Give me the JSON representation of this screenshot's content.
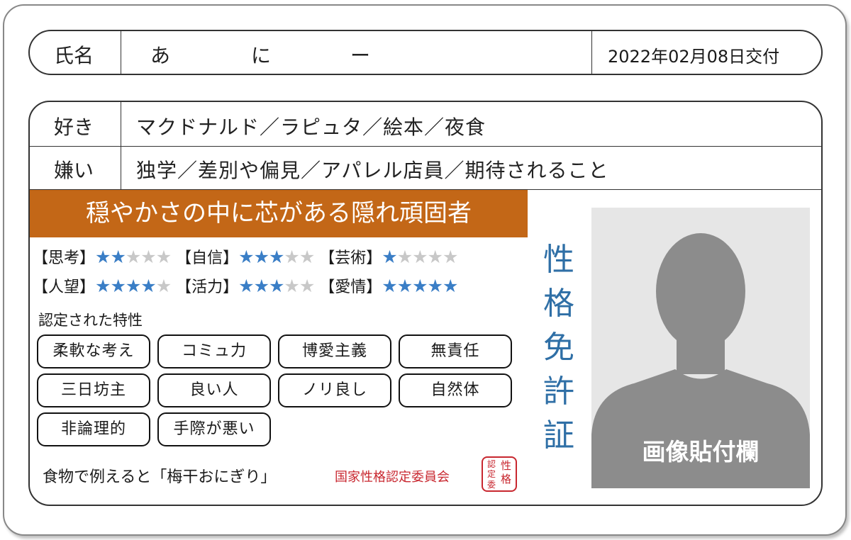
{
  "header": {
    "name_label": "氏名",
    "name_chars": [
      "あ",
      "に",
      "ー"
    ],
    "issue_date": "2022年02月08日交付"
  },
  "likes": {
    "label": "好き",
    "value": "マクドナルド／ラピュタ／絵本／夜食"
  },
  "dislikes": {
    "label": "嫌い",
    "value": "独学／差別や偏見／アパレル店員／期待されること"
  },
  "type_title": "穏やかさの中に芯がある隠れ頑固者",
  "ratings": [
    {
      "label": "【思考】",
      "stars": 2
    },
    {
      "label": "【自信】",
      "stars": 3
    },
    {
      "label": "【芸術】",
      "stars": 1
    },
    {
      "label": "【人望】",
      "stars": 4
    },
    {
      "label": "【活力】",
      "stars": 3
    },
    {
      "label": "【愛情】",
      "stars": 5
    }
  ],
  "star_glyph": "★",
  "max_stars": 5,
  "traits_heading": "認定された特性",
  "traits": [
    "柔軟な考え",
    "コミュ力",
    "博愛主義",
    "無責任",
    "三日坊主",
    "良い人",
    "ノリ良し",
    "自然体",
    "非論理的",
    "手際が悪い"
  ],
  "food_line": "食物で例えると「梅干おにぎり」",
  "authority": "国家性格認定委員会",
  "seal_chars": [
    "性",
    "格",
    "認",
    "定",
    "委"
  ],
  "vertical_title": [
    "性",
    "格",
    "免",
    "許",
    "証"
  ],
  "photo_label": "画像貼付欄",
  "colors": {
    "accent_orange": "#c36717",
    "star_blue": "#3a7ec6",
    "title_blue": "#2f6fa6",
    "seal_red": "#c8272f",
    "photo_gray": "#8c8c8c"
  }
}
